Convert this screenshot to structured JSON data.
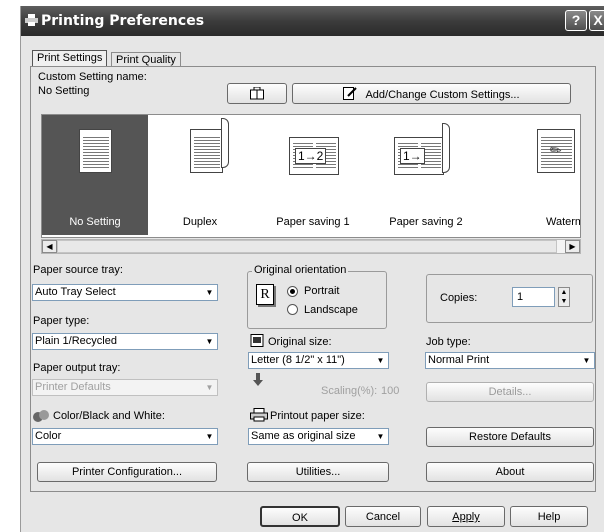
{
  "window": {
    "title": "Printing Preferences",
    "help_button": "?",
    "close_button": "X"
  },
  "tabs": [
    {
      "label": "Print Settings",
      "active": true
    },
    {
      "label": "Print Quality",
      "active": false
    }
  ],
  "custom_setting": {
    "label": "Custom Setting name:",
    "value": "No Setting",
    "add_change_label": "Add/Change Custom Settings..."
  },
  "presets": [
    {
      "label": "No Setting",
      "selected": true,
      "icon": "blank-page-icon"
    },
    {
      "label": "Duplex",
      "selected": false,
      "icon": "duplex-page-icon"
    },
    {
      "label": "Paper saving 1",
      "selected": false,
      "icon": "two-up-page-icon",
      "badge": "1→2"
    },
    {
      "label": "Paper saving 2",
      "selected": false,
      "icon": "two-up-duplex-icon",
      "badge": "1→"
    },
    {
      "label": "Watermark (I",
      "selected": false,
      "icon": "watermark-page-icon"
    }
  ],
  "paper_source": {
    "label": "Paper source tray:",
    "value": "Auto Tray Select"
  },
  "paper_type": {
    "label": "Paper type:",
    "value": "Plain 1/Recycled"
  },
  "paper_output": {
    "label": "Paper output tray:",
    "value": "Printer Defaults"
  },
  "color_mode": {
    "label": "Color/Black and White:",
    "value": "Color"
  },
  "orientation": {
    "legend": "Original orientation",
    "preview_letter": "R",
    "options": [
      {
        "label": "Portrait",
        "checked": true
      },
      {
        "label": "Landscape",
        "checked": false
      }
    ]
  },
  "original_size": {
    "label": "Original size:",
    "value": "Letter (8 1/2\" x 11\")"
  },
  "scaling": {
    "label": "Scaling(%):",
    "value": "100"
  },
  "printout_size": {
    "label": "Printout paper size:",
    "value": "Same as original size"
  },
  "copies": {
    "label": "Copies:",
    "value": "1"
  },
  "job_type": {
    "label": "Job type:",
    "value": "Normal Print"
  },
  "buttons": {
    "details": "Details...",
    "restore_defaults": "Restore Defaults",
    "printer_configuration": "Printer Configuration...",
    "utilities": "Utilities...",
    "about": "About",
    "ok": "OK",
    "cancel": "Cancel",
    "apply": "Apply",
    "help": "Help"
  }
}
